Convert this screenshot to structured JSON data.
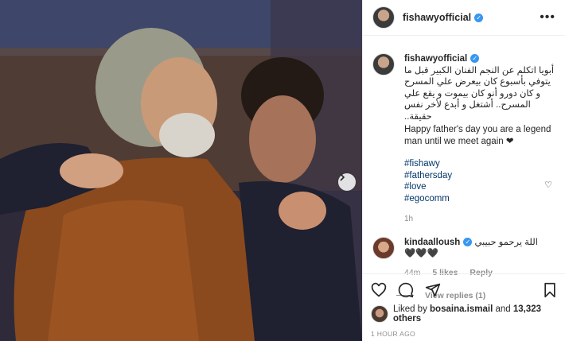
{
  "post": {
    "username": "fishawyofficial",
    "caption_arabic": "أبويا اتكلم عن النجم الفنان الكبير قبل ما يتوفي بأسبوع كان بيعرض علي المسرح و كان دورو أنو كان بيموت و يقع علي المسرح.. أشتغل و أبدع لأخر نفس حقيقة..",
    "caption_english": "Happy father's day you are a legend man until we meet again ❤",
    "hashtags": [
      "#fishawy",
      "#fathersday",
      "#love",
      "#egocomm"
    ],
    "caption_time": "1h"
  },
  "comment": {
    "username": "kindaalloush",
    "text": "اللة يرحمو حبيبي 🖤🖤🖤",
    "time": "44m",
    "likes": "5 likes",
    "reply": "Reply",
    "view_replies": "View replies (1)"
  },
  "likes": {
    "prefix": "Liked by ",
    "user": "bosaina.ismail",
    "middle": " and ",
    "count": "13,323 others"
  },
  "posted_ago": "1 HOUR AGO",
  "icons": [
    "more-icon",
    "heart-icon",
    "comment-icon",
    "share-icon",
    "bookmark-icon",
    "chevron-right-icon",
    "verified-icon"
  ],
  "colors": {
    "verified": "#3897f0",
    "link": "#00376b",
    "muted": "#8e8e8e"
  }
}
